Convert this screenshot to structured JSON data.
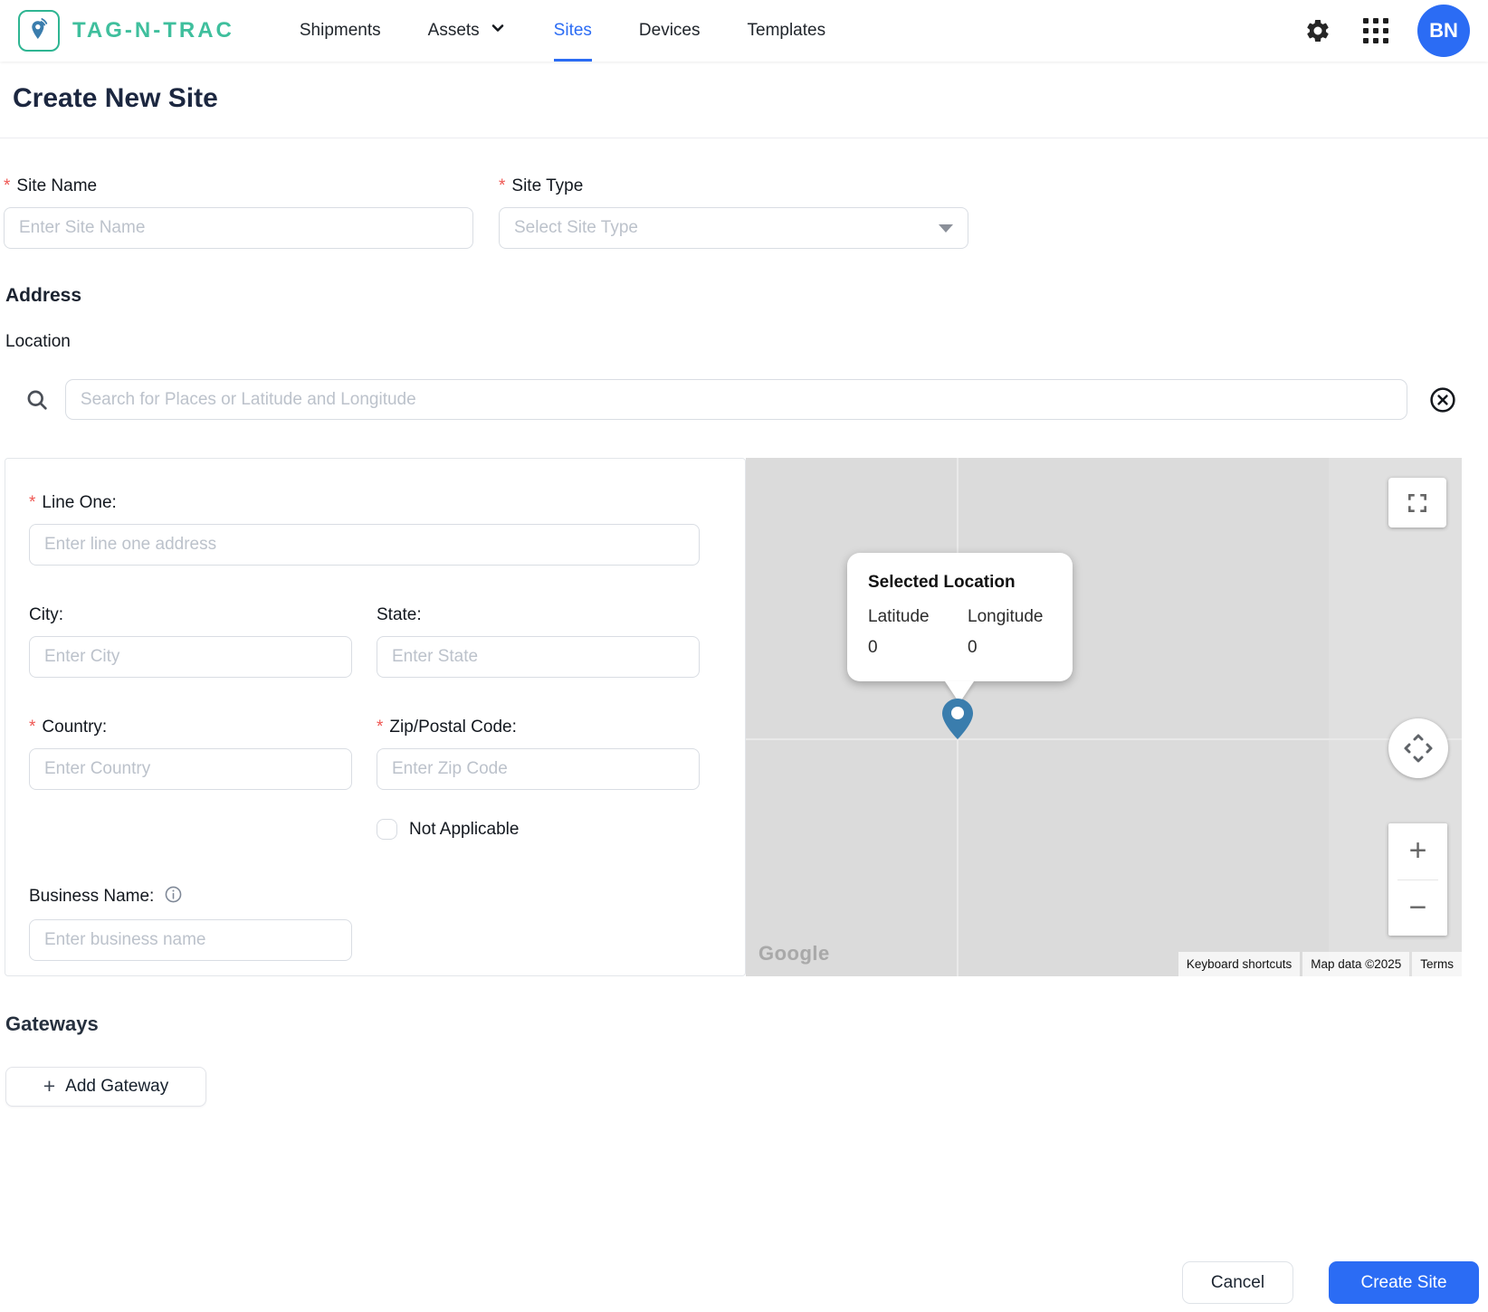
{
  "brand": {
    "name": "TAG-N-TRAC"
  },
  "nav": {
    "items": [
      {
        "label": "Shipments"
      },
      {
        "label": "Assets",
        "has_dropdown": true
      },
      {
        "label": "Sites",
        "active": true
      },
      {
        "label": "Devices"
      },
      {
        "label": "Templates"
      }
    ]
  },
  "user": {
    "initials": "BN"
  },
  "page": {
    "title": "Create New Site",
    "required_marker": "*"
  },
  "form": {
    "site_name": {
      "label": "Site Name",
      "placeholder": "Enter Site Name"
    },
    "site_type": {
      "label": "Site Type",
      "placeholder": "Select Site Type"
    },
    "section_address": "Address",
    "location_label": "Location",
    "search_placeholder": "Search for Places or Latitude and Longitude",
    "line_one": {
      "label": "Line One:",
      "placeholder": "Enter line one address"
    },
    "city": {
      "label": "City:",
      "placeholder": "Enter City"
    },
    "state": {
      "label": "State:",
      "placeholder": "Enter State"
    },
    "country": {
      "label": "Country:",
      "placeholder": "Enter Country"
    },
    "zip": {
      "label": "Zip/Postal Code:",
      "placeholder": "Enter Zip Code"
    },
    "not_applicable": "Not Applicable",
    "business_name": {
      "label": "Business Name:",
      "placeholder": "Enter business name"
    }
  },
  "map": {
    "tooltip": {
      "title": "Selected Location",
      "lat_label": "Latitude",
      "lng_label": "Longitude",
      "lat_value": "0",
      "lng_value": "0"
    },
    "google_logo": "Google",
    "attribution": {
      "keyboard_shortcuts": "Keyboard shortcuts",
      "map_data": "Map data ©2025",
      "terms": "Terms"
    },
    "controls": {
      "zoom_in": "+",
      "zoom_out": "−"
    }
  },
  "gateways": {
    "heading": "Gateways",
    "add_icon": "+",
    "add_label": "Add Gateway"
  },
  "footer": {
    "cancel": "Cancel",
    "create": "Create Site"
  },
  "colors": {
    "accent_blue": "#2b6cf4",
    "brand_teal": "#3fbf9d",
    "pin_blue": "#3a7dad",
    "required_red": "#ef5753",
    "map_gray": "#dbdbdb"
  }
}
